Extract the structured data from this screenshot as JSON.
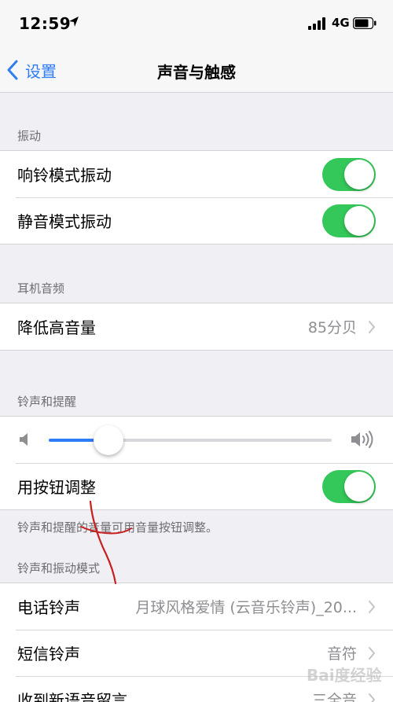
{
  "status": {
    "time": "12:59",
    "network": "4G"
  },
  "nav": {
    "back_label": "设置",
    "title": "声音与触感"
  },
  "vibrate": {
    "header": "振动",
    "ring_vibrate_label": "响铃模式振动",
    "silent_vibrate_label": "静音模式振动",
    "ring_vibrate_on": true,
    "silent_vibrate_on": true
  },
  "headphone": {
    "header": "耳机音频",
    "reduce_label": "降低高音量",
    "reduce_value": "85分贝"
  },
  "ringer": {
    "header": "铃声和提醒",
    "volume_level": 0.2,
    "change_with_buttons_label": "用按钮调整",
    "change_with_buttons_on": true,
    "footer": "铃声和提醒的音量可用音量按钮调整。"
  },
  "patterns": {
    "header": "铃声和振动模式",
    "rows": [
      {
        "label": "电话铃声",
        "value": "月球风格爱情 (云音乐铃声)_20..."
      },
      {
        "label": "短信铃声",
        "value": "音符"
      },
      {
        "label": "收到新语音留言",
        "value": "三全音"
      }
    ]
  },
  "watermark": {
    "text": "Bai度经验"
  },
  "colors": {
    "accent": "#2f7cf6",
    "toggle_on": "#34c759",
    "scribble": "#c8201e"
  }
}
